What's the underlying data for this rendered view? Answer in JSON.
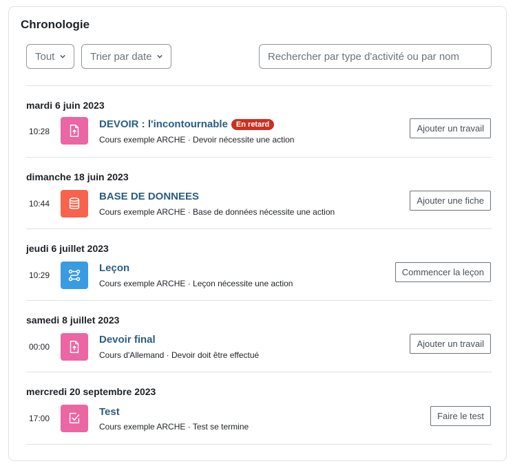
{
  "block": {
    "title": "Chronologie",
    "filter_label": "Tout",
    "sort_label": "Trier par date",
    "search_placeholder": "Rechercher par type d'activité ou par nom"
  },
  "events": [
    {
      "date": "mardi 6 juin 2023",
      "time": "10:28",
      "icon": "assignment-upload-icon",
      "icon_color": "#eb66a2",
      "title": "DEVOIR : l'incontournable",
      "badge": "En retard",
      "subtitle": "Cours exemple ARCHE · Devoir nécessite une action",
      "action": "Ajouter un travail"
    },
    {
      "date": "dimanche 18 juin 2023",
      "time": "10:44",
      "icon": "database-icon",
      "icon_color": "#f7634d",
      "title": "BASE DE DONNEES",
      "badge": "",
      "subtitle": "Cours exemple ARCHE · Base de données nécessite une action",
      "action": "Ajouter une fiche"
    },
    {
      "date": "jeudi 6 juillet 2023",
      "time": "10:29",
      "icon": "lesson-path-icon",
      "icon_color": "#399be2",
      "title": "Leçon",
      "badge": "",
      "subtitle": "Cours exemple ARCHE · Leçon nécessite une action",
      "action": "Commencer la leçon"
    },
    {
      "date": "samedi 8 juillet 2023",
      "time": "00:00",
      "icon": "assignment-upload-icon",
      "icon_color": "#eb66a2",
      "title": "Devoir final",
      "badge": "",
      "subtitle": "Cours d'Allemand · Devoir doit être effectué",
      "action": "Ajouter un travail"
    },
    {
      "date": "mercredi 20 septembre 2023",
      "time": "17:00",
      "icon": "quiz-check-icon",
      "icon_color": "#eb66a2",
      "title": "Test",
      "badge": "",
      "subtitle": "Cours exemple ARCHE · Test se termine",
      "action": "Faire le test"
    }
  ]
}
